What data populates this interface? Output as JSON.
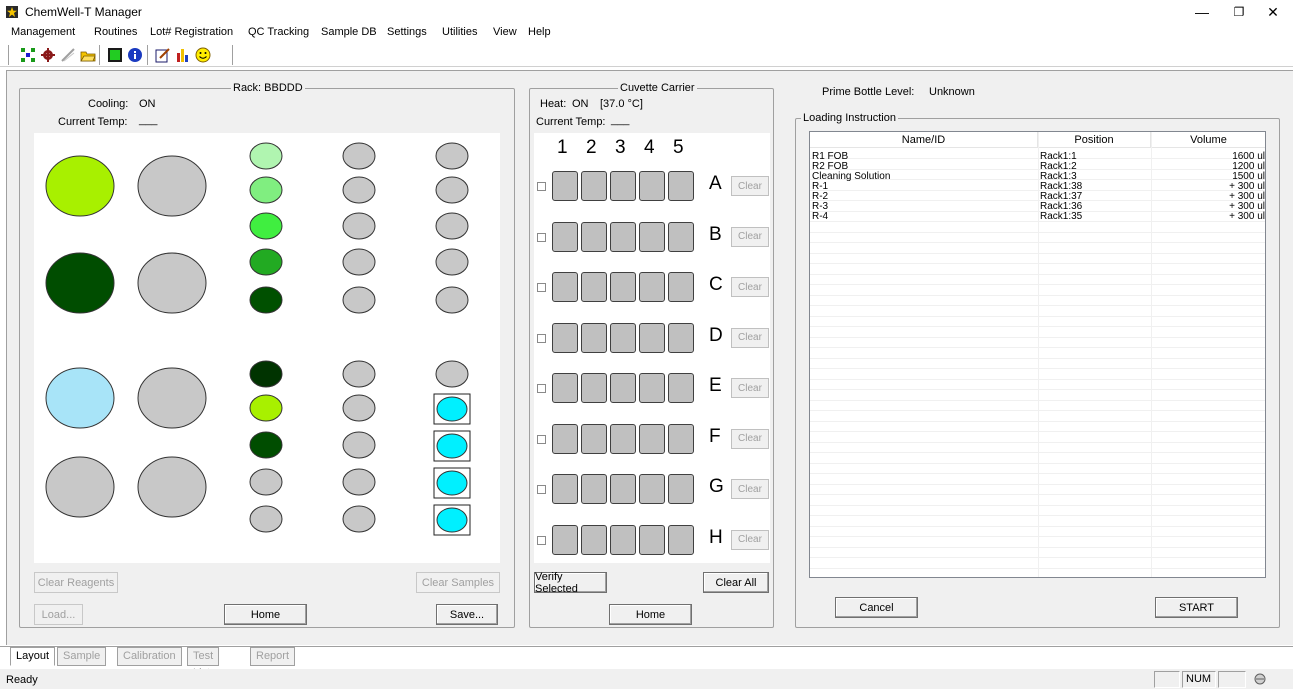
{
  "window": {
    "title": "ChemWell-T Manager",
    "controls": [
      "minimize",
      "restore",
      "close"
    ]
  },
  "menu": [
    "Management",
    "Routines",
    "Lot# Registration",
    "QC Tracking",
    "Sample DB",
    "Settings",
    "Utilities",
    "View",
    "Help"
  ],
  "toolbar": {
    "icons": [
      "layout-icon",
      "gear-bug-icon",
      "probe-icon",
      "folder-open-icon",
      "monitor-icon",
      "info-icon",
      "edit-icon",
      "chart-icon",
      "smiley-icon"
    ]
  },
  "rack": {
    "title": "Rack: BBDDD",
    "cooling_label": "Cooling:",
    "cooling_value": "ON",
    "temp_label": "Current Temp:",
    "temp_value": "___",
    "clear_reagents": "Clear Reagents",
    "clear_samples": "Clear Samples",
    "load": "Load...",
    "home": "Home",
    "save": "Save...",
    "colors": {
      "lime": "#a8f000",
      "dark_green": "#004d00",
      "light_blue": "#a8e4f8",
      "gray": "#c8c8c8",
      "pale_green": "#b0f5b0",
      "light_green": "#80ee80",
      "bright_green": "#40ee40",
      "mid_green": "#22aa22",
      "deep_green": "#005000",
      "darkest_green": "#003300",
      "cyan": "#00f0ff"
    }
  },
  "cuvette": {
    "title": "Cuvette Carrier",
    "heat_label": "Heat:",
    "heat_value": "ON",
    "heat_temp": "[37.0 °C]",
    "temp_label": "Current Temp:",
    "temp_value": "___",
    "columns": [
      "1",
      "2",
      "3",
      "4",
      "5"
    ],
    "rows": [
      "A",
      "B",
      "C",
      "D",
      "E",
      "F",
      "G",
      "H"
    ],
    "clear_label": "Clear",
    "verify_selected": "Verify Selected",
    "clear_all": "Clear All",
    "home": "Home"
  },
  "prime": {
    "label": "Prime Bottle Level:",
    "value": "Unknown"
  },
  "loading": {
    "title": "Loading Instruction",
    "columns": [
      "Name/ID",
      "Position",
      "Volume"
    ],
    "rows": [
      [
        "R1 FOB",
        "Rack1:1",
        "1600 ul"
      ],
      [
        "R2 FOB",
        "Rack1:2",
        "1200 ul"
      ],
      [
        "Cleaning Solution",
        "Rack1:3",
        "1500 ul"
      ],
      [
        "R-1",
        "Rack1:38",
        "+ 300 ul"
      ],
      [
        "R-2",
        "Rack1:37",
        "+ 300 ul"
      ],
      [
        "R-3",
        "Rack1:36",
        "+ 300 ul"
      ],
      [
        "R-4",
        "Rack1:35",
        "+ 300 ul"
      ]
    ],
    "cancel": "Cancel",
    "start": "START"
  },
  "tabs": [
    "Layout",
    "Sample",
    "Calibration",
    "Test List",
    "Report"
  ],
  "status": {
    "text": "Ready",
    "num": "NUM"
  }
}
